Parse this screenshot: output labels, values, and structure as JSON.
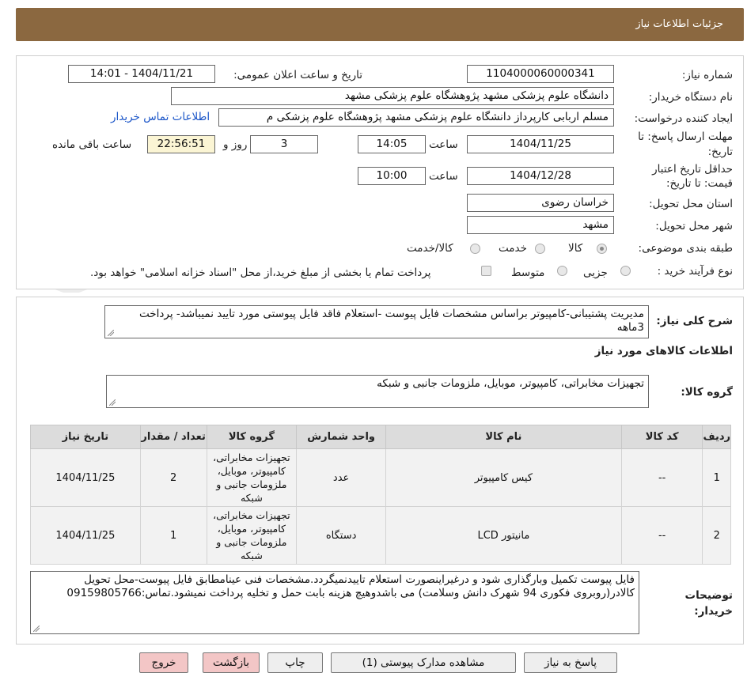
{
  "page": {
    "title": "جزئیات اطلاعات نیاز"
  },
  "form": {
    "need_number_label": "شماره نیاز:",
    "need_number": "1104000060000341",
    "announce_label": "تاریخ و ساعت اعلان عمومی:",
    "announce_value": "1404/11/21 - 14:01",
    "buyer_org_label": "نام دستگاه خریدار:",
    "buyer_org": "دانشگاه علوم پزشکی مشهد   پژوهشگاه علوم پزشکی مشهد",
    "creator_label": "ایجاد کننده درخواست:",
    "creator": "مسلم اربابی کارپرداز دانشگاه علوم پزشکی مشهد   پژوهشگاه علوم پزشکی م",
    "buyer_contact_link": "اطلاعات تماس خریدار",
    "deadline_label_1": "مهلت ارسال پاسخ: تا",
    "deadline_label_2": "تاریخ:",
    "deadline_date": "1404/11/25",
    "hour_label": "ساعت",
    "deadline_time": "14:05",
    "days_left": "3",
    "days_label": "روز و",
    "time_left": "22:56:51",
    "remaining_label": "ساعت باقی مانده",
    "validity_label_1": "حداقل تاریخ اعتبار",
    "validity_label_2": "قیمت: تا تاریخ:",
    "validity_date": "1404/12/28",
    "validity_hour_label": "ساعت",
    "validity_time": "10:00",
    "province_label": "استان محل تحویل:",
    "province": "خراسان رضوی",
    "city_label": "شهر محل تحویل:",
    "city": "مشهد",
    "category_label": "طبقه بندی موضوعی:",
    "category_options": [
      "کالا",
      "خدمت",
      "کالا/خدمت"
    ],
    "category_selected": "کالا",
    "process_label": "نوع فرآیند خرید :",
    "process_options": [
      "جزیی",
      "متوسط"
    ],
    "process_note": "پرداخت تمام یا بخشی از مبلغ خرید،از محل \"اسناد خزانه اسلامی\" خواهد بود."
  },
  "description": {
    "label": "شرح کلی نیاز:",
    "text": "مدیریت پشتیبانی-کامپیوتر  براساس مشخصات فایل پیوست -استعلام فاقد فایل پیوستی مورد تایید نمیباشد- پرداخت 3ماهه"
  },
  "goods": {
    "section_title": "اطلاعات کالاهای مورد نیاز",
    "group_label": "گروه کالا:",
    "group_value": "تجهیزات مخابراتی، کامپیوتر، موبایل، ملزومات جانبی و شبکه",
    "columns": [
      "ردیف",
      "کد کالا",
      "نام کالا",
      "واحد شمارش",
      "گروه کالا",
      "تعداد / مقدار",
      "تاریخ نیاز"
    ],
    "rows": [
      {
        "row": "1",
        "code": "--",
        "name": "کیس کامپیوتر",
        "unit": "عدد",
        "group": "تجهیزات مخابراتی، کامپیوتر، موبایل، ملزومات جانبی و شبکه",
        "qty": "2",
        "date": "1404/11/25"
      },
      {
        "row": "2",
        "code": "--",
        "name": "مانیتور LCD",
        "unit": "دستگاه",
        "group": "تجهیزات مخابراتی، کامپیوتر، موبایل، ملزومات جانبی و شبکه",
        "qty": "1",
        "date": "1404/11/25"
      }
    ]
  },
  "buyer_notes": {
    "label_1": "توضیحات",
    "label_2": "خریدار:",
    "text": "فایل پیوست تکمیل وبارگذاری شود و درغیراینصورت استعلام تاییدنمیگردد.مشخصات فنی عینامطابق فایل پیوست-محل تحویل کالادر(روبروی فکوری 94 شهرک دانش وسلامت) می باشدوهیچ هزینه بابت حمل و تخلیه پرداخت نمیشود.تماس:09159805766"
  },
  "buttons": {
    "reply": "پاسخ به نیاز",
    "attachments": "مشاهده مدارک پیوستی (1)",
    "print": "چاپ",
    "back": "بازگشت",
    "exit": "خروج"
  },
  "watermark": {
    "text": "AriaTender.neT"
  },
  "colors": {
    "header_bg": "#8b6840",
    "link": "#1a55c8",
    "countdown_bg": "#fbf5d4",
    "exit_bg": "#f3c6c6"
  }
}
